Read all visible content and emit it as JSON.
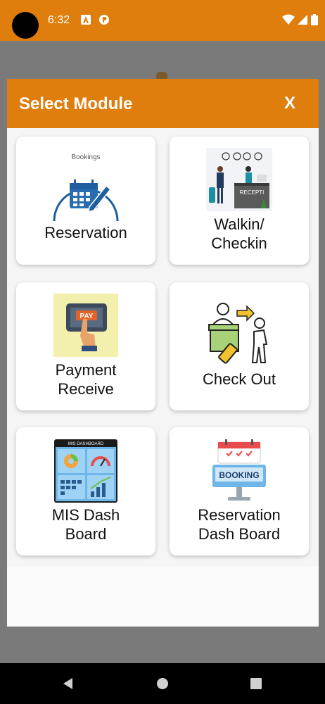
{
  "status_bar": {
    "time": "6:32"
  },
  "dialog": {
    "title": "Select Module",
    "close_label": "X"
  },
  "modules": [
    {
      "label": "Reservation",
      "icon": "reservation-calendar-icon",
      "image_caption": "Bookings"
    },
    {
      "label": "Walkin/\nCheckin",
      "icon": "reception-walkin-icon",
      "image_caption": "RECEPTI"
    },
    {
      "label": "Payment\nReceive",
      "icon": "payment-pay-icon",
      "image_caption": "PAY"
    },
    {
      "label": "Check Out",
      "icon": "checkout-luggage-icon"
    },
    {
      "label": "MIS Dash\nBoard",
      "icon": "mis-dashboard-icon",
      "image_caption": "MIS DASHBOARD"
    },
    {
      "label": "Reservation\nDash Board",
      "icon": "booking-dashboard-icon",
      "image_caption": "BOOKING"
    }
  ],
  "colors": {
    "accent": "#e07e0d",
    "scrim": "#7a7a7a",
    "card": "#ffffff"
  }
}
